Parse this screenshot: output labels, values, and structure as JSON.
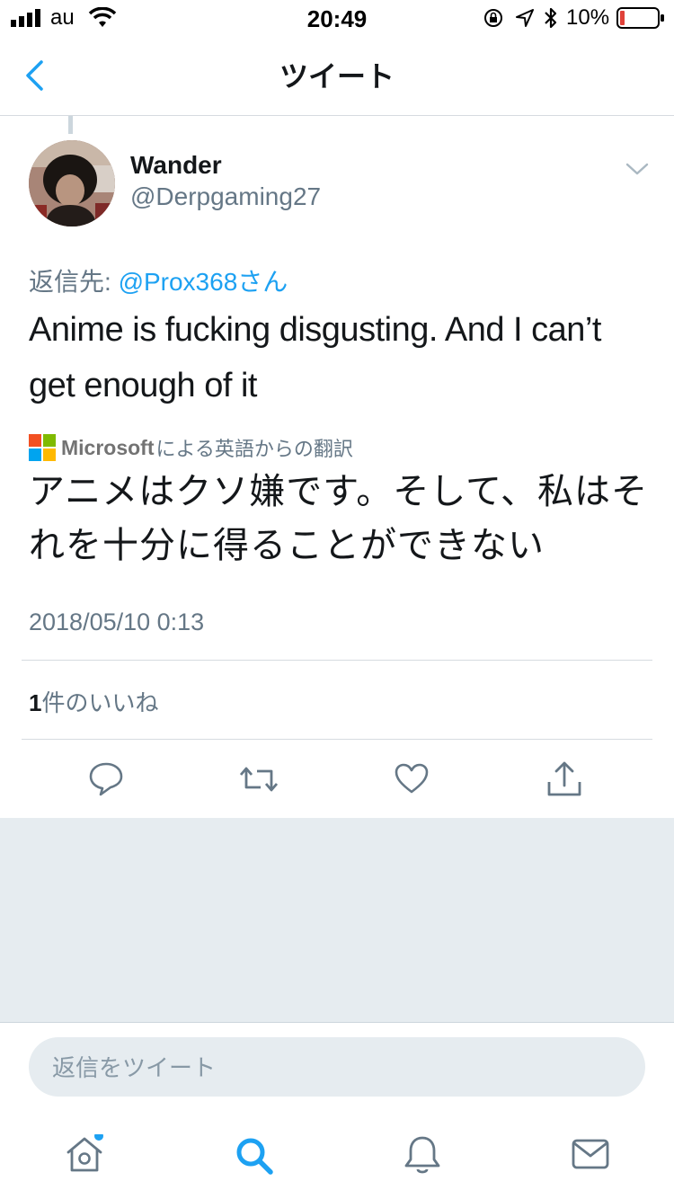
{
  "status_bar": {
    "carrier": "au",
    "time": "20:49",
    "battery": "10%"
  },
  "nav": {
    "title": "ツイート"
  },
  "tweet": {
    "name": "Wander",
    "handle": "@Derpgaming27",
    "reply_prefix": "返信先: ",
    "reply_mention": "@Prox368さん",
    "text": "Anime is fucking disgusting. And I can’t get enough of it",
    "translation_brand": "Microsoft",
    "translation_label": "による英語からの翻訳",
    "translation": "アニメはクソ嫌です。そして、私はそれを十分に得ることができない",
    "timestamp": "2018/05/10 0:13",
    "like_count": "1",
    "like_label": "件のいいね"
  },
  "reply": {
    "placeholder": "返信をツイート"
  },
  "tab_bar": {
    "items": [
      "home",
      "search",
      "notifications",
      "messages"
    ]
  },
  "colors": {
    "accent": "#1da1f2",
    "text": "#14171a",
    "secondary": "#657786",
    "background_gray": "#e6ecf0"
  }
}
